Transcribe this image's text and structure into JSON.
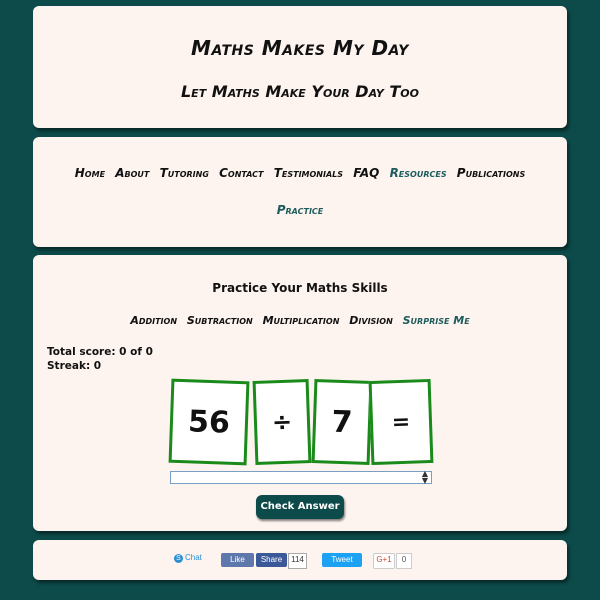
{
  "header": {
    "title": "Maths Makes My Day",
    "subtitle": "Let Maths Make Your Day Too"
  },
  "nav": {
    "items": [
      {
        "label": "Home",
        "active": false
      },
      {
        "label": "About",
        "active": false
      },
      {
        "label": "Tutoring",
        "active": false
      },
      {
        "label": "Contact",
        "active": false
      },
      {
        "label": "Testimonials",
        "active": false
      },
      {
        "label": "FAQ",
        "active": false
      },
      {
        "label": "Resources",
        "active": true
      },
      {
        "label": "Publications",
        "active": false
      },
      {
        "label": "Practice",
        "active": true
      }
    ]
  },
  "practice": {
    "title": "Practice Your Maths Skills",
    "operations": [
      {
        "label": "Addition",
        "active": false
      },
      {
        "label": "Subtraction",
        "active": false
      },
      {
        "label": "Multiplication",
        "active": false
      },
      {
        "label": "Division",
        "active": false
      },
      {
        "label": "Surprise Me",
        "active": true
      }
    ],
    "score_text": "Total score: 0 of 0",
    "streak_text": "Streak: 0",
    "cards": [
      "56",
      "÷",
      "7",
      "="
    ],
    "answer_value": "",
    "check_button": "Check Answer"
  },
  "footer": {
    "skype_label": "Chat",
    "fb_like": "Like",
    "fb_share": "Share",
    "fb_count": "114",
    "tweet": "Tweet",
    "gplus": "G+1",
    "gplus_count": "0"
  },
  "colors": {
    "background": "#0d4a4a",
    "panel": "#fdf4f0",
    "card_border": "#1a8a1a",
    "active_link": "#1d5c5c"
  }
}
